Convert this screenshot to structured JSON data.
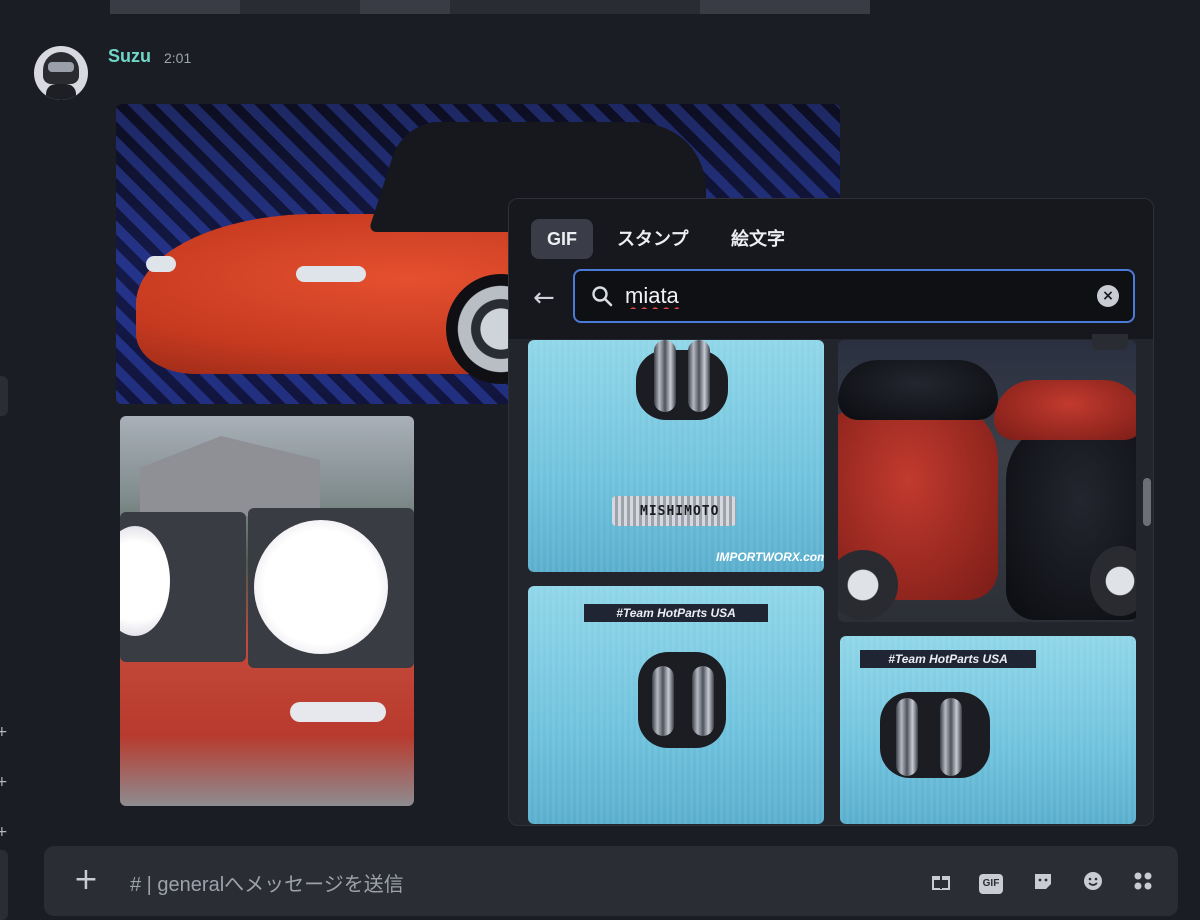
{
  "message": {
    "author": "Suzu",
    "timestamp": "2:01"
  },
  "picker": {
    "tabs": [
      {
        "label": "GIF",
        "active": true
      },
      {
        "label": "スタンプ",
        "active": false
      },
      {
        "label": "絵文字",
        "active": false
      }
    ],
    "search": {
      "value": "miata"
    },
    "results": [
      {
        "id": "gif-1",
        "icon": "twin-turbo-engine",
        "labels": [
          "MISHIMOTO",
          "IMPORTWORX.com"
        ]
      },
      {
        "id": "gif-2",
        "icon": "parked-roadsters",
        "labels": []
      },
      {
        "id": "gif-3",
        "icon": "twin-turbo-engine",
        "labels": [
          "#Team HotParts USA"
        ]
      },
      {
        "id": "gif-4",
        "icon": "twin-turbo-engine",
        "labels": [
          "#Team HotParts USA"
        ]
      }
    ]
  },
  "composer": {
    "placeholder": "# | generalへメッセージを送信",
    "gif_chip": "GIF",
    "tools": [
      "gift-icon",
      "gif-icon",
      "sticker-icon",
      "emoji-icon",
      "apps-icon"
    ]
  },
  "colors": {
    "background": "#1b1d24",
    "author": "#6fd6c8",
    "search_border": "#4a7bd8",
    "picker_head": "#17181d"
  }
}
